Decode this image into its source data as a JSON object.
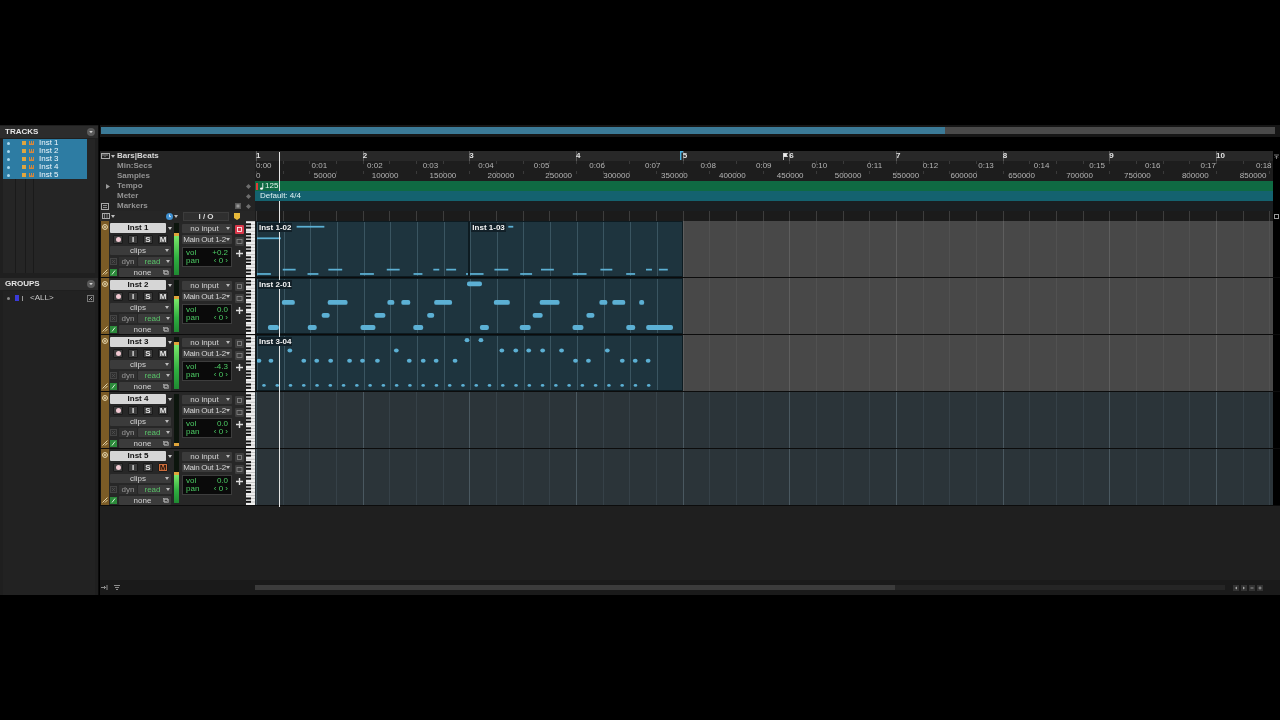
{
  "tracks_panel": {
    "title": "TRACKS",
    "items": [
      {
        "name": "Inst 1",
        "selected": true
      },
      {
        "name": "Inst 2",
        "selected": true
      },
      {
        "name": "Inst 3",
        "selected": true
      },
      {
        "name": "Inst 4",
        "selected": true
      },
      {
        "name": "Inst 5",
        "selected": true
      }
    ]
  },
  "groups_panel": {
    "title": "GROUPS",
    "items": [
      {
        "name": "<ALL>"
      }
    ]
  },
  "rulers": [
    {
      "kind": "bars",
      "label": "Bars|Beats",
      "ticks": [
        "1",
        "2",
        "3",
        "4",
        "5",
        "6",
        "7",
        "8",
        "9",
        "10"
      ]
    },
    {
      "kind": "time",
      "label": "Min:Secs",
      "ticks": [
        "0:00",
        "0:01",
        "0:02",
        "0:03",
        "0:04",
        "0:05",
        "0:06",
        "0:07",
        "0:08",
        "0:09",
        "0:10",
        "0:11",
        "0:12",
        "0:13",
        "0:14",
        "0:15",
        "0:16",
        "0:17",
        "0:18"
      ]
    },
    {
      "kind": "samples",
      "label": "Samples",
      "ticks": [
        "0",
        "50000",
        "100000",
        "150000",
        "200000",
        "250000",
        "300000",
        "350000",
        "400000",
        "450000",
        "500000",
        "550000",
        "600000",
        "650000",
        "700000",
        "750000",
        "800000",
        "850000"
      ]
    }
  ],
  "tempo_ruler": {
    "label": "Tempo",
    "value": "125"
  },
  "meter_ruler": {
    "label": "Meter",
    "value": "Default: 4/4"
  },
  "markers_ruler": {
    "label": "Markers"
  },
  "track_header": {
    "io_label": "I / O"
  },
  "tracks": [
    {
      "name": "Inst 1",
      "input_button": "I",
      "solo_button": "S",
      "mute_button": "M",
      "muted": false,
      "view": "clips",
      "dyn_button": "dyn",
      "automation": "read",
      "group": "none",
      "level": 0.8,
      "input": "no input",
      "output": "Main Out 1-2",
      "vol_label": "vol",
      "vol": "+0.2",
      "pan_label": "pan",
      "pan": "‹ 0 ›",
      "side_button_lit": true,
      "clips": [
        {
          "name": "Inst 1-02",
          "kind": "lines"
        },
        {
          "name": "Inst 1-03",
          "kind": "lines"
        }
      ]
    },
    {
      "name": "Inst 2",
      "input_button": "I",
      "solo_button": "S",
      "mute_button": "M",
      "muted": false,
      "view": "clips",
      "dyn_button": "dyn",
      "automation": "read",
      "group": "none",
      "level": 0.7,
      "input": "no input",
      "output": "Main Out 1-2",
      "vol_label": "vol",
      "vol": "0.0",
      "pan_label": "pan",
      "pan": "‹ 0 ›",
      "side_button_lit": false,
      "clips": [
        {
          "name": "Inst 2-01",
          "kind": "blocks"
        }
      ]
    },
    {
      "name": "Inst 3",
      "input_button": "I",
      "solo_button": "S",
      "mute_button": "M",
      "muted": false,
      "view": "clips",
      "dyn_button": "dyn",
      "automation": "read",
      "group": "none",
      "level": 0.9,
      "input": "no input",
      "output": "Main Out 1-2",
      "vol_label": "vol",
      "vol": "-4.3",
      "pan_label": "pan",
      "pan": "‹ 0 ›",
      "side_button_lit": false,
      "clips": [
        {
          "name": "Inst 3-04",
          "kind": "dots"
        }
      ]
    },
    {
      "name": "Inst 4",
      "input_button": "I",
      "solo_button": "S",
      "mute_button": "M",
      "muted": false,
      "view": "clips",
      "dyn_button": "dyn",
      "automation": "read",
      "group": "none",
      "level": 0.05,
      "input": "no input",
      "output": "Main Out 1-2",
      "vol_label": "vol",
      "vol": "0.0",
      "pan_label": "pan",
      "pan": "‹ 0 ›",
      "side_button_lit": false
    },
    {
      "name": "Inst 5",
      "input_button": "I",
      "solo_button": "S",
      "mute_button": "M",
      "muted": true,
      "view": "clips",
      "dyn_button": "dyn",
      "automation": "read",
      "group": "none",
      "level": 0.6,
      "input": "no input",
      "output": "Main Out 1-2",
      "vol_label": "vol",
      "vol": "0.0",
      "pan_label": "pan",
      "pan": "‹ 0 ›",
      "side_button_lit": false
    }
  ]
}
